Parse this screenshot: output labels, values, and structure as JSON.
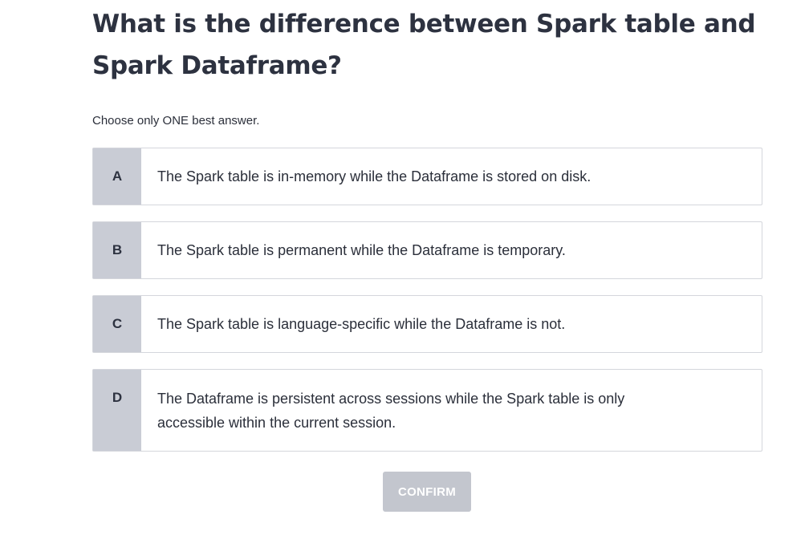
{
  "question": {
    "title": "What is the difference between Spark table and Spark Dataframe?",
    "instruction": "Choose only ONE best answer."
  },
  "options": [
    {
      "letter": "A",
      "text": "The Spark table is in-memory while the Dataframe is stored on disk."
    },
    {
      "letter": "B",
      "text": "The Spark table is permanent while the Dataframe is temporary."
    },
    {
      "letter": "C",
      "text": "The Spark table is language-specific while the Dataframe is not."
    },
    {
      "letter": "D",
      "text": "The Dataframe is persistent across sessions while the Spark table is only accessible within the current session."
    }
  ],
  "actions": {
    "confirm_label": "CONFIRM"
  },
  "colors": {
    "letter_background": "#c9ccd5",
    "confirm_background_disabled": "#c3c6ce",
    "border": "#d4d6dc",
    "text": "#2b2f3a"
  }
}
